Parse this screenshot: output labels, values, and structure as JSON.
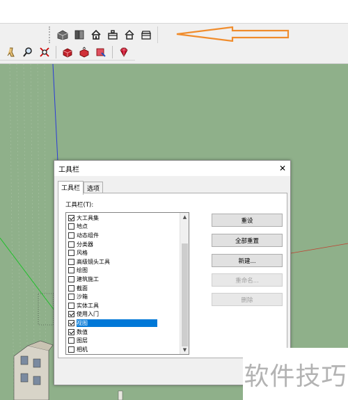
{
  "toolbar": {
    "views": [
      {
        "icon": "iso-view-icon"
      },
      {
        "icon": "top-view-icon"
      },
      {
        "icon": "front-view-icon"
      },
      {
        "icon": "right-view-icon"
      },
      {
        "icon": "back-view-icon"
      },
      {
        "icon": "left-view-icon"
      }
    ],
    "tools": [
      {
        "icon": "walk-icon"
      },
      {
        "icon": "zoom-icon"
      },
      {
        "icon": "zoom-extents-icon"
      },
      {
        "icon": "warehouse-icon"
      },
      {
        "icon": "share-model-icon"
      },
      {
        "icon": "extension-warehouse-icon"
      },
      {
        "icon": "ruby-icon"
      }
    ]
  },
  "annotation": {
    "arrow_color": "#f08c2c"
  },
  "dialog": {
    "title": "工具栏",
    "close_glyph": "✕",
    "tabs": [
      {
        "label": "工具栏",
        "active": true
      },
      {
        "label": "选项",
        "active": false
      }
    ],
    "list_label": "工具栏(T):",
    "items": [
      {
        "label": "大工具集",
        "checked": true,
        "selected": false
      },
      {
        "label": "地点",
        "checked": false,
        "selected": false
      },
      {
        "label": "动态组件",
        "checked": false,
        "selected": false
      },
      {
        "label": "分类器",
        "checked": false,
        "selected": false
      },
      {
        "label": "风格",
        "checked": false,
        "selected": false
      },
      {
        "label": "高级镜头工具",
        "checked": false,
        "selected": false
      },
      {
        "label": "绘图",
        "checked": false,
        "selected": false
      },
      {
        "label": "建筑施工",
        "checked": false,
        "selected": false
      },
      {
        "label": "截面",
        "checked": false,
        "selected": false
      },
      {
        "label": "沙箱",
        "checked": false,
        "selected": false
      },
      {
        "label": "实体工具",
        "checked": false,
        "selected": false
      },
      {
        "label": "使用入门",
        "checked": true,
        "selected": false
      },
      {
        "label": "视图",
        "checked": true,
        "selected": true
      },
      {
        "label": "数值",
        "checked": true,
        "selected": false
      },
      {
        "label": "图层",
        "checked": false,
        "selected": false
      },
      {
        "label": "相机",
        "checked": false,
        "selected": false
      }
    ],
    "buttons": [
      {
        "label": "重设",
        "enabled": true
      },
      {
        "label": "全部重置",
        "enabled": true
      },
      {
        "label": "新建...",
        "enabled": true
      },
      {
        "label": "重命名...",
        "enabled": false
      },
      {
        "label": "删除",
        "enabled": false
      }
    ],
    "selection_color": "#0078d7"
  },
  "watermark": {
    "text": "软件技巧"
  }
}
